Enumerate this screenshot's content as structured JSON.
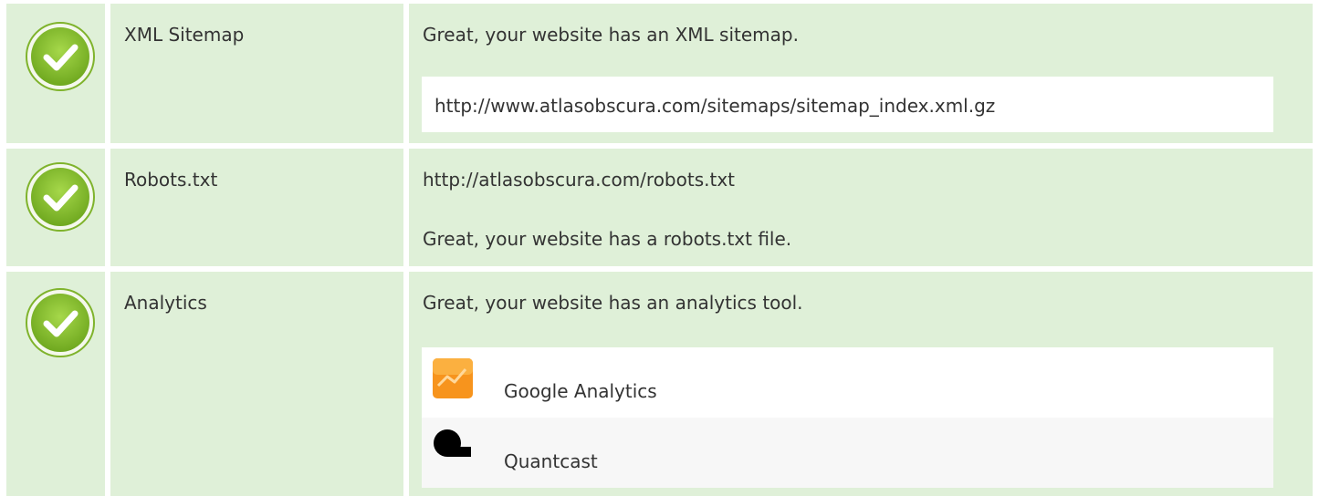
{
  "rows": [
    {
      "label": "XML Sitemap",
      "status": "check-icon",
      "message": "Great, your website has an XML sitemap.",
      "url": "http://www.atlasobscura.com/sitemaps/sitemap_index.xml.gz"
    },
    {
      "label": "Robots.txt",
      "status": "check-icon",
      "url": "http://atlasobscura.com/robots.txt",
      "message": "Great, your website has a robots.txt file."
    },
    {
      "label": "Analytics",
      "status": "check-icon",
      "message": "Great, your website has an analytics tool.",
      "tools": [
        {
          "name": "Google Analytics",
          "icon": "google-analytics-icon"
        },
        {
          "name": "Quantcast",
          "icon": "quantcast-icon"
        }
      ]
    }
  ],
  "colors": {
    "row_background": "#dff0d8",
    "check_green": "#8cc63f",
    "text": "#333333",
    "ga_orange": "#f7941d"
  }
}
